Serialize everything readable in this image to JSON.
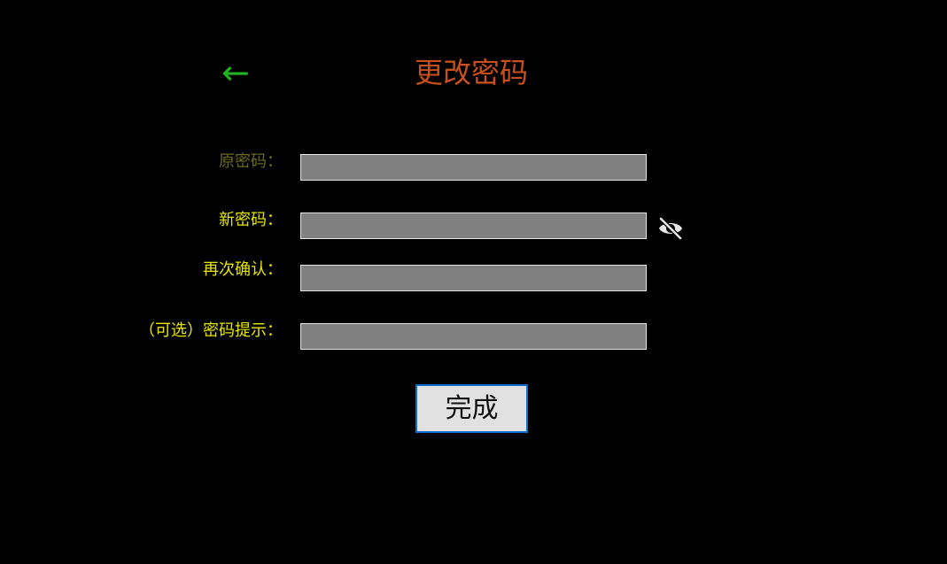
{
  "header": {
    "back_symbol": "←",
    "title": "更改密码"
  },
  "form": {
    "old_password_label": "原密码：",
    "new_password_label": "新密码：",
    "confirm_password_label": "再次确认：",
    "hint_label": "（可选）密码提示：",
    "old_password_value": "",
    "new_password_value": "",
    "confirm_password_value": "",
    "hint_value": ""
  },
  "actions": {
    "done_label": "完成"
  },
  "icons": {
    "back": "back-arrow-icon",
    "visibility": "eye-off-icon"
  },
  "colors": {
    "background": "#000000",
    "title": "#c8501e",
    "back_arrow": "#22b322",
    "old_password_label": "#6b6b1e",
    "label": "#e6e600",
    "input_fill": "#808080",
    "button_border": "#0f6ed4"
  }
}
